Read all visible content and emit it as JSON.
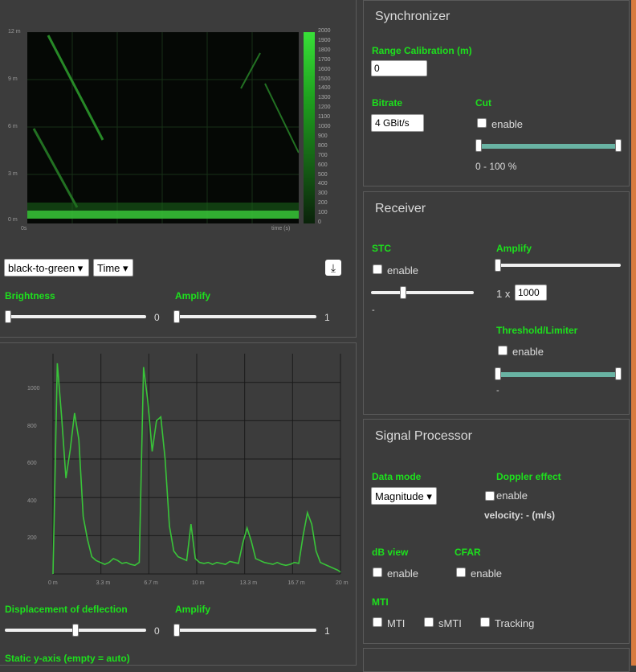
{
  "waterfall": {
    "y_labels": [
      "12 m",
      "9 m",
      "6 m",
      "3 m",
      "0 m"
    ],
    "x_start": "0s",
    "x_end": "time (s)",
    "colorbar_labels": [
      "2000",
      "1900",
      "1800",
      "1700",
      "1600",
      "1500",
      "1400",
      "1300",
      "1200",
      "1100",
      "1000",
      "900",
      "800",
      "700",
      "600",
      "500",
      "400",
      "300",
      "200",
      "100",
      "0"
    ]
  },
  "controls_top": {
    "colormap_select": "black-to-green",
    "axis_select": "Time",
    "brightness_label": "Brightness",
    "brightness_value": "0",
    "brightness_level": 0,
    "amplify_label": "Amplify",
    "amplify_value": "1",
    "amplify_level": 0,
    "download_icon": "download-icon"
  },
  "line_chart": {
    "y_labels": [
      "1000",
      "800",
      "600",
      "400",
      "200"
    ],
    "x_labels": [
      "0 m",
      "3.3 m",
      "6.7 m",
      "10 m",
      "13.3 m",
      "16.7 m",
      "20 m"
    ],
    "chart_data": {
      "type": "line",
      "x": [
        0,
        0.3,
        0.6,
        0.9,
        1.2,
        1.5,
        1.8,
        2.1,
        2.4,
        2.7,
        3.0,
        3.3,
        3.6,
        3.9,
        4.2,
        4.5,
        4.8,
        5.1,
        5.4,
        5.7,
        6.0,
        6.3,
        6.6,
        6.9,
        7.2,
        7.5,
        7.8,
        8.1,
        8.4,
        8.7,
        9.0,
        9.3,
        9.6,
        9.9,
        10.2,
        10.5,
        10.8,
        11.1,
        11.4,
        11.7,
        12.0,
        12.3,
        12.6,
        12.9,
        13.2,
        13.5,
        13.8,
        14.1,
        14.4,
        14.7,
        15.0,
        15.3,
        15.6,
        15.9,
        16.2,
        16.5,
        16.8,
        17.1,
        17.4,
        17.7,
        18.0,
        18.3,
        18.6,
        18.9,
        19.2,
        19.5,
        19.8,
        20.0
      ],
      "values": [
        0,
        1100,
        820,
        500,
        650,
        840,
        700,
        300,
        180,
        90,
        70,
        60,
        50,
        60,
        80,
        70,
        55,
        60,
        50,
        45,
        60,
        1080,
        900,
        640,
        800,
        820,
        600,
        250,
        120,
        90,
        80,
        70,
        260,
        80,
        60,
        55,
        60,
        50,
        60,
        55,
        50,
        65,
        60,
        55,
        160,
        240,
        170,
        80,
        70,
        60,
        55,
        50,
        60,
        50,
        45,
        50,
        60,
        55,
        200,
        320,
        260,
        120,
        60,
        50,
        40,
        30,
        20,
        10
      ],
      "xlim": [
        0,
        20
      ],
      "ylim": [
        0,
        1150
      ],
      "grid": true
    }
  },
  "controls_bottom": {
    "displacement_label": "Displacement of deflection",
    "displacement_value": "0",
    "displacement_level": 0.5,
    "amplify_label": "Amplify",
    "amplify_value": "1",
    "amplify_level": 0,
    "static_y_label": "Static y-axis (empty = auto)"
  },
  "synchronizer": {
    "title": "Synchronizer",
    "range_label": "Range Calibration (m)",
    "range_value": "0",
    "bitrate_label": "Bitrate",
    "bitrate_value": "4 GBit/s",
    "cut_label": "Cut",
    "cut_enable": "enable",
    "cut_range": "0 - 100 %",
    "cut_low": 0,
    "cut_high": 1
  },
  "receiver": {
    "title": "Receiver",
    "stc_label": "STC",
    "stc_enable": "enable",
    "stc_level": 0.3,
    "stc_value": "-",
    "amplify_label": "Amplify",
    "amplify_prefix": "1 x",
    "amplify_value": "1000",
    "amplify_level": 0,
    "threshold_label": "Threshold/Limiter",
    "threshold_enable": "enable",
    "threshold_value": "-",
    "threshold_low": 0,
    "threshold_high": 1
  },
  "signal_processor": {
    "title": "Signal Processor",
    "data_mode_label": "Data mode",
    "data_mode_value": "Magnitude",
    "doppler_label": "Doppler effect",
    "doppler_enable": "enable",
    "velocity_text": "velocity: - (m/s)",
    "db_view_label": "dB view",
    "db_view_enable": "enable",
    "cfar_label": "CFAR",
    "cfar_enable": "enable",
    "mti_label": "MTI",
    "mti_option": "MTI",
    "smti_option": "sMTI",
    "tracking_option": "Tracking"
  },
  "colors": {
    "accent_green": "#1de01d",
    "panel_bg": "#3c3c3c",
    "slider_teal": "#69b3a3",
    "window_edge": "#d87b3f"
  }
}
